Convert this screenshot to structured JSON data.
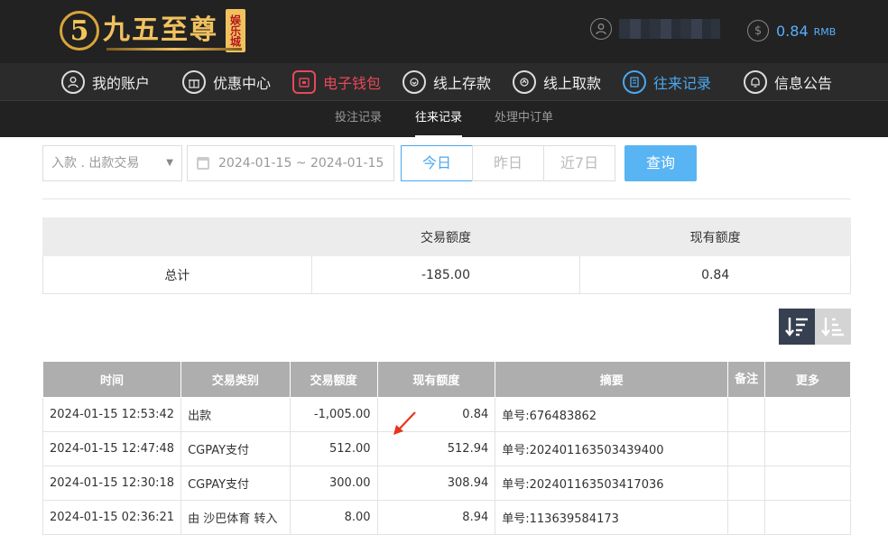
{
  "header": {
    "logo_glyph": "5",
    "logo_text": "九五至尊",
    "logo_tag": "娱乐城",
    "user_icon": "user-icon",
    "balance_icon": "dollar-icon",
    "balance_value": "0.84",
    "balance_unit": "RMB"
  },
  "nav": {
    "items": [
      {
        "label": "我的账户",
        "icon": "user-icon",
        "state": "normal"
      },
      {
        "label": "优惠中心",
        "icon": "gift-icon",
        "state": "normal"
      },
      {
        "label": "电子钱包",
        "icon": "wallet-icon",
        "state": "highlight-red"
      },
      {
        "label": "线上存款",
        "icon": "deposit-icon",
        "state": "normal"
      },
      {
        "label": "线上取款",
        "icon": "withdraw-icon",
        "state": "normal"
      },
      {
        "label": "往来记录",
        "icon": "records-icon",
        "state": "active"
      },
      {
        "label": "信息公告",
        "icon": "bell-icon",
        "state": "normal"
      }
    ]
  },
  "subnav": {
    "items": [
      {
        "label": "投注记录",
        "active": false
      },
      {
        "label": "往来记录",
        "active": true
      },
      {
        "label": "处理中订单",
        "active": false
      }
    ]
  },
  "filters": {
    "type_select": "入款 . 出款交易",
    "date_range": "2024-01-15 ~ 2024-01-15",
    "ranges": [
      {
        "label": "今日",
        "active": true
      },
      {
        "label": "昨日",
        "active": false
      },
      {
        "label": "近7日",
        "active": false
      }
    ],
    "query_label": "查询"
  },
  "summary": {
    "headers": [
      "",
      "交易额度",
      "现有额度"
    ],
    "row": {
      "label": "总计",
      "amount": "-185.00",
      "balance": "0.84"
    }
  },
  "records": {
    "columns": [
      "时间",
      "交易类别",
      "交易额度",
      "现有额度",
      "摘要",
      "备注",
      "更多"
    ],
    "rows": [
      {
        "time": "2024-01-15 12:53:42",
        "type": "出款",
        "amount": "-1,005.00",
        "balance": "0.84",
        "summary": "单号:676483862",
        "note": "",
        "more": ""
      },
      {
        "time": "2024-01-15 12:47:48",
        "type": "CGPAY支付",
        "amount": "512.00",
        "balance": "512.94",
        "summary": "单号:202401163503439400",
        "note": "",
        "more": ""
      },
      {
        "time": "2024-01-15 12:30:18",
        "type": "CGPAY支付",
        "amount": "300.00",
        "balance": "308.94",
        "summary": "单号:202401163503417036",
        "note": "",
        "more": ""
      },
      {
        "time": "2024-01-15 02:36:21",
        "type": "由 沙巴体育 转入",
        "amount": "8.00",
        "balance": "8.94",
        "summary": "单号:113639584173",
        "note": "",
        "more": ""
      }
    ]
  },
  "colors": {
    "accent_blue": "#4aa8f0",
    "highlight_red": "#e94858",
    "header_bg": "#222222",
    "gold": "#f0c15e"
  }
}
